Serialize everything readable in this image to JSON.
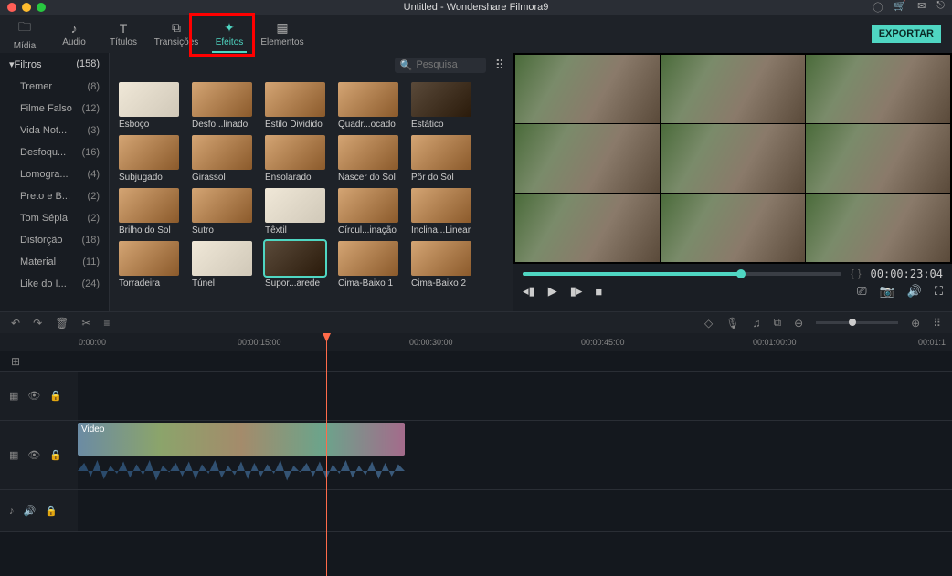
{
  "title": "Untitled - Wondershare Filmora9",
  "tabs": {
    "midia": "Mídia",
    "audio": "Áudio",
    "titulos": "Títulos",
    "transicoes": "Transições",
    "efeitos": "Efeitos",
    "elementos": "Elementos"
  },
  "export_label": "EXPORTAR",
  "sidebar": {
    "header": "Filtros",
    "header_count": "(158)",
    "items": [
      {
        "label": "Tremer",
        "count": "(8)"
      },
      {
        "label": "Filme Falso",
        "count": "(12)"
      },
      {
        "label": "Vida Not...",
        "count": "(3)"
      },
      {
        "label": "Desfoqu...",
        "count": "(16)"
      },
      {
        "label": "Lomogra...",
        "count": "(4)"
      },
      {
        "label": "Preto e B...",
        "count": "(2)"
      },
      {
        "label": "Tom Sépia",
        "count": "(2)"
      },
      {
        "label": "Distorção",
        "count": "(18)"
      },
      {
        "label": "Material",
        "count": "(11)"
      },
      {
        "label": "Like do I...",
        "count": "(24)"
      }
    ]
  },
  "search": {
    "placeholder": "Pesquisa"
  },
  "effects": [
    {
      "label": "Esboço",
      "cls": "light"
    },
    {
      "label": "Desfo...linado",
      "cls": ""
    },
    {
      "label": "Estilo Dividido",
      "cls": ""
    },
    {
      "label": "Quadr...ocado",
      "cls": ""
    },
    {
      "label": "Estático",
      "cls": "dark"
    },
    {
      "label": "Subjugado",
      "cls": ""
    },
    {
      "label": "Girassol",
      "cls": ""
    },
    {
      "label": "Ensolarado",
      "cls": ""
    },
    {
      "label": "Nascer do Sol",
      "cls": ""
    },
    {
      "label": "Pôr do Sol",
      "cls": ""
    },
    {
      "label": "Brilho do Sol",
      "cls": ""
    },
    {
      "label": "Sutro",
      "cls": ""
    },
    {
      "label": "Têxtil",
      "cls": "light"
    },
    {
      "label": "Círcul...inação",
      "cls": ""
    },
    {
      "label": "Inclina...Linear",
      "cls": ""
    },
    {
      "label": "Torradeira",
      "cls": ""
    },
    {
      "label": "Túnel",
      "cls": "light"
    },
    {
      "label": "Supor...arede",
      "cls": "dark",
      "selected": true
    },
    {
      "label": "Cima-Baixo 1",
      "cls": ""
    },
    {
      "label": "Cima-Baixo 2",
      "cls": ""
    }
  ],
  "preview": {
    "timecode": "00:00:23:04"
  },
  "timeline": {
    "marks": [
      "0:00:00",
      "00:00:15:00",
      "00:00:30:00",
      "00:00:45:00",
      "00:01:00:00",
      "00:01:1"
    ],
    "clip_label": "Video"
  }
}
